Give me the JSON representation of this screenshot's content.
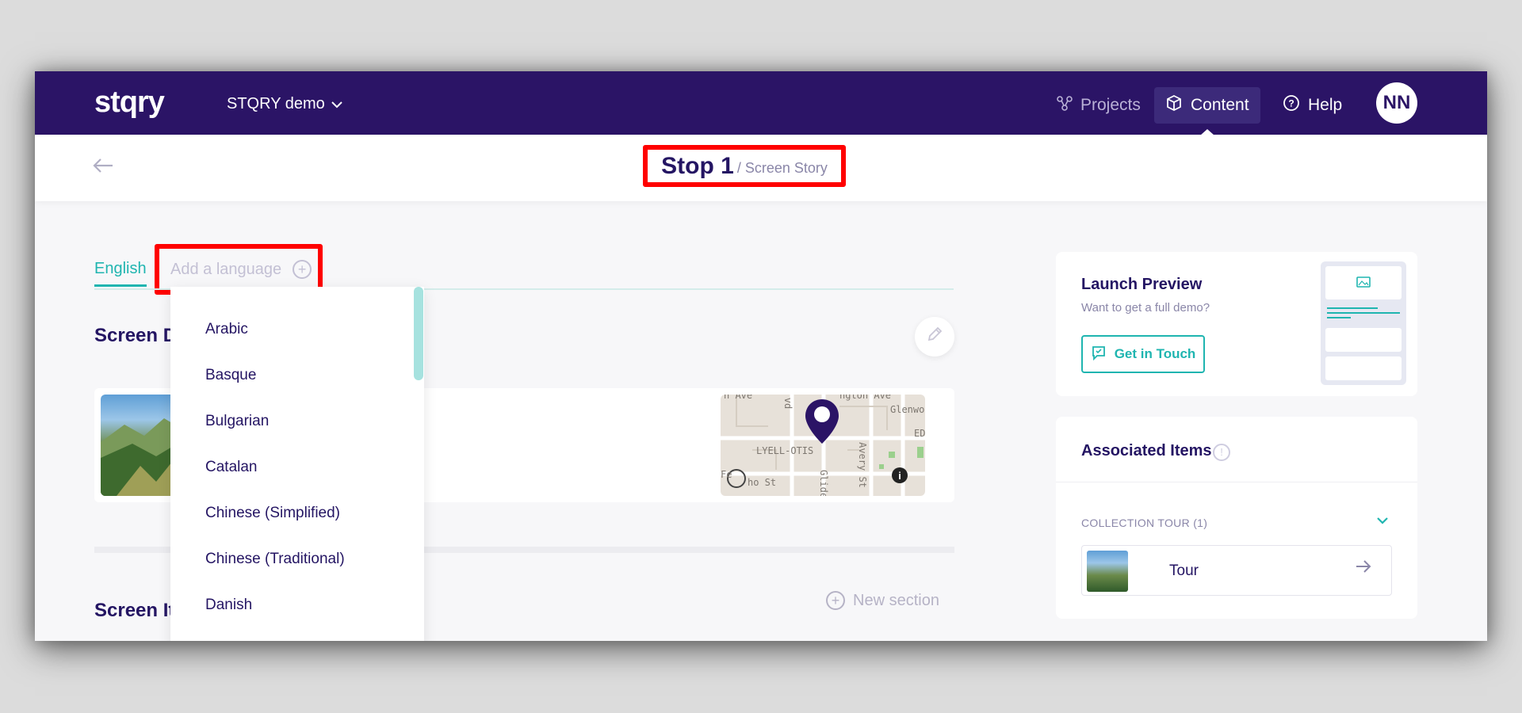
{
  "header": {
    "logo": "stqry",
    "project": "STQRY demo",
    "nav": {
      "projects": "Projects",
      "content": "Content",
      "help": "Help"
    },
    "avatar": "NN"
  },
  "titlebar": {
    "title": "Stop 1",
    "subtitle": "/ Screen Story"
  },
  "languages": {
    "active": "English",
    "add_label": "Add a language"
  },
  "sections": {
    "screen_details_partial": "Screen D",
    "screen_items_partial": "Screen It",
    "new_section": "New section"
  },
  "map": {
    "labels": [
      "LYELL-OTIS",
      "Avery St",
      "Glenwo",
      "Glide",
      "Fe",
      "ho St",
      "ED",
      "ngton Ave",
      "vd",
      "n Ave"
    ]
  },
  "dropdown": {
    "options": [
      "Arabic",
      "Basque",
      "Bulgarian",
      "Catalan",
      "Chinese (Simplified)",
      "Chinese (Traditional)",
      "Danish"
    ]
  },
  "launch": {
    "title": "Launch Preview",
    "subtitle": "Want to get a full demo?",
    "button": "Get in Touch"
  },
  "associated": {
    "title": "Associated Items",
    "collection": "COLLECTION TOUR (1)",
    "item": "Tour"
  },
  "colors": {
    "brand": "#2b1466",
    "accent": "#1fb5b0",
    "highlight": "#ff0000"
  },
  "icons": [
    "chevron-down-icon",
    "projects-icon",
    "box-icon",
    "help-icon",
    "back-arrow-icon",
    "plus-circle-icon",
    "pencil-icon",
    "map-pin-icon",
    "chat-icon",
    "info-icon",
    "arrow-right-icon"
  ]
}
